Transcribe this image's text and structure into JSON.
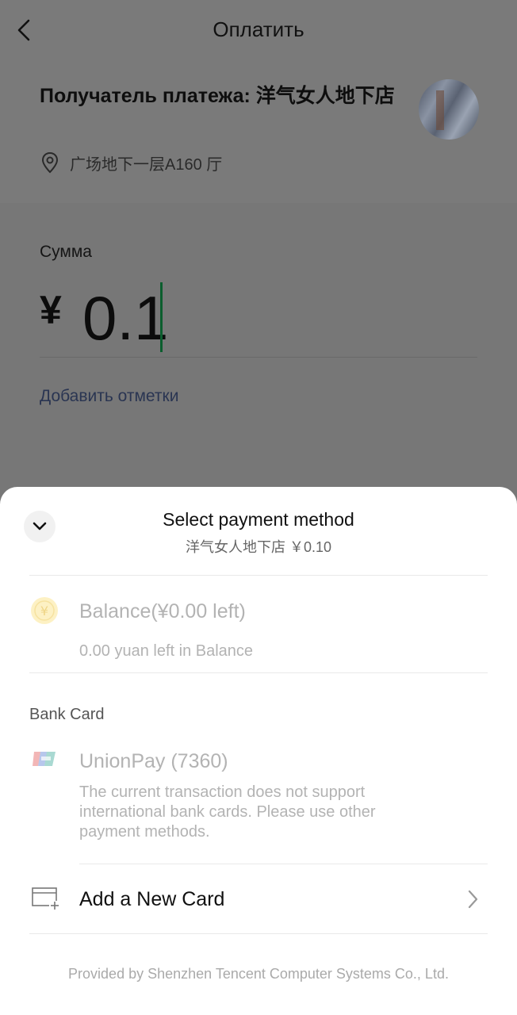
{
  "header": {
    "title": "Оплатить"
  },
  "merchant": {
    "name": "Получатель платежа: 洋气女人地下店",
    "location": "广场地下一层A160 厅"
  },
  "payment": {
    "amount_label": "Сумма",
    "currency_symbol": "¥",
    "amount_value": "0.1",
    "add_note": "Добавить отметки"
  },
  "sheet": {
    "title": "Select payment method",
    "subtitle": "洋气女人地下店 ￥0.10",
    "balance": {
      "title": "Balance(¥0.00 left)",
      "description": "0.00 yuan left in Balance",
      "icon": "yuan-coin-icon"
    },
    "bank_card_label": "Bank Card",
    "unionpay": {
      "title": "UnionPay (7360)",
      "description": "The current transaction does not support international bank cards. Please use other payment methods.",
      "icon": "unionpay-logo-icon"
    },
    "add_card": {
      "label": "Add a New Card",
      "icon": "add-card-icon"
    },
    "footer": "Provided by Shenzhen Tencent Computer Systems Co., Ltd."
  },
  "colors": {
    "overlay": "#777777",
    "sheet_bg": "#ffffff",
    "caret": "#0b5e2e",
    "disabled_text": "#b3b3b3",
    "link": "#2a3552"
  }
}
